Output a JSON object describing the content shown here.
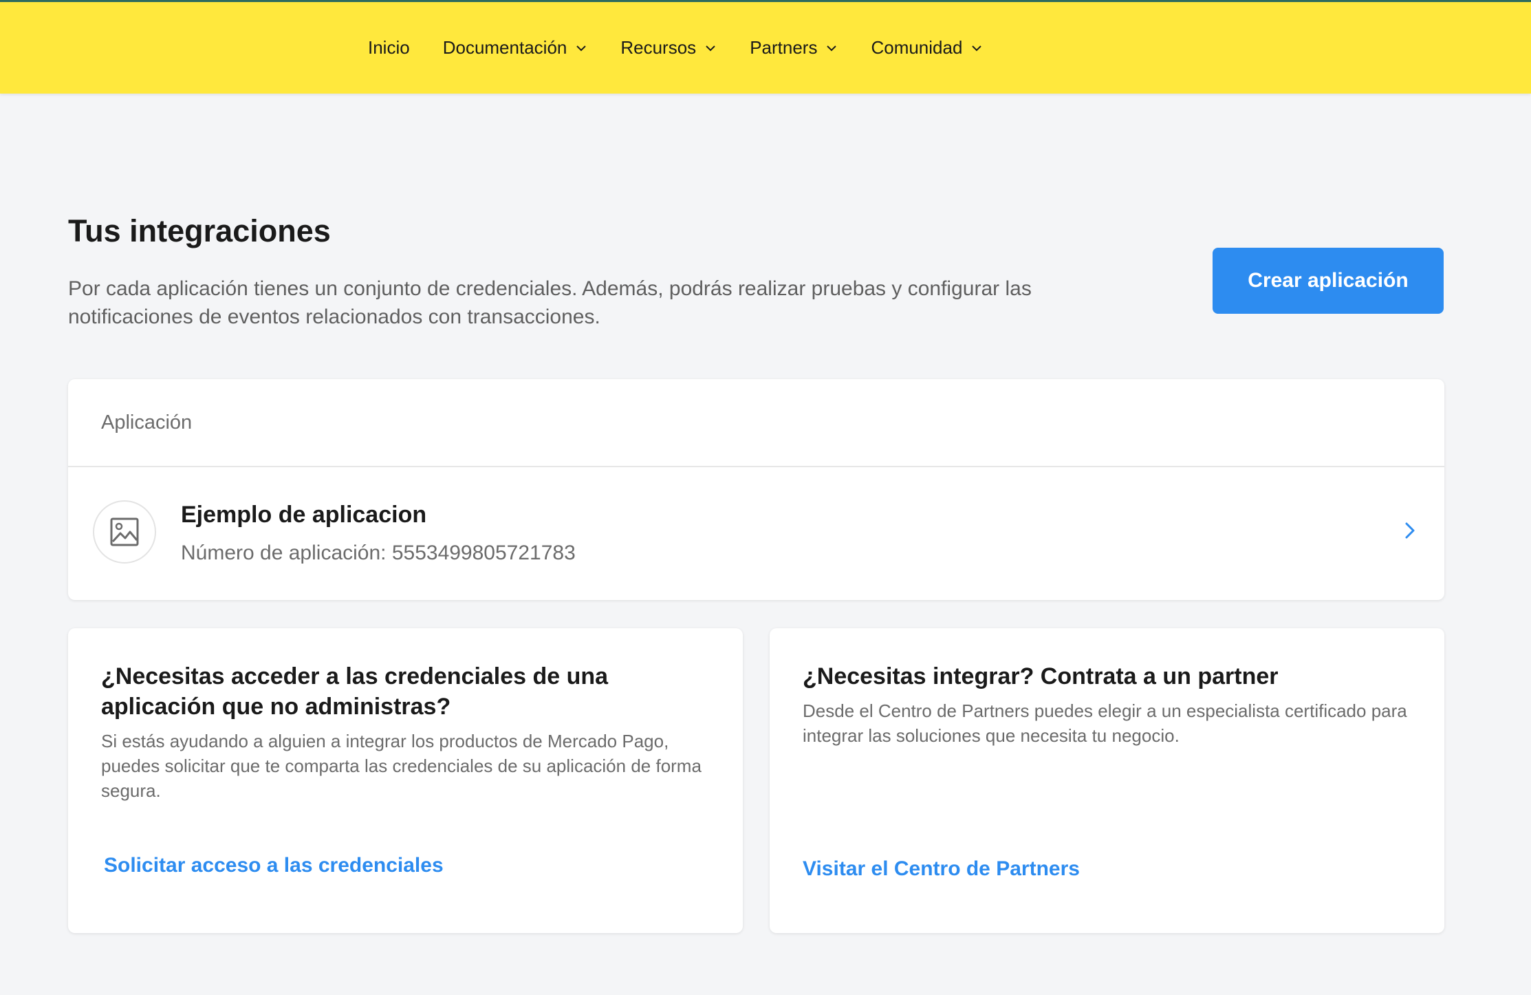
{
  "colors": {
    "header_bg": "#ffe83d",
    "accent_blue": "#2d8cf0",
    "page_bg": "#f4f5f7"
  },
  "nav": {
    "items": [
      {
        "label": "Inicio",
        "has_dropdown": false
      },
      {
        "label": "Documentación",
        "has_dropdown": true,
        "icon": "chevron-down-icon"
      },
      {
        "label": "Recursos",
        "has_dropdown": true,
        "icon": "chevron-down-icon"
      },
      {
        "label": "Partners",
        "has_dropdown": true,
        "icon": "chevron-down-icon"
      },
      {
        "label": "Comunidad",
        "has_dropdown": true,
        "icon": "chevron-down-icon"
      }
    ]
  },
  "page": {
    "title": "Tus integraciones",
    "description": "Por cada aplicación tienes un conjunto de credenciales. Además, podrás realizar pruebas y configurar las notificaciones de eventos relacionados con transacciones.",
    "create_button": "Crear aplicación"
  },
  "applications": {
    "header": "Aplicación",
    "items": [
      {
        "name": "Ejemplo de aplicacion",
        "number_text": "Número de aplicación: 5553499805721783",
        "icon": "image-placeholder-icon"
      }
    ]
  },
  "cards": {
    "credentials": {
      "title": "¿Necesitas acceder a las credenciales de una aplicación que no administras?",
      "text": "Si estás ayudando a alguien a integrar los productos de Mercado Pago, puedes solicitar que te comparta las credenciales de su aplicación de forma segura.",
      "link": "Solicitar acceso a las credenciales"
    },
    "partners": {
      "title": "¿Necesitas integrar? Contrata a un partner",
      "text": "Desde el Centro de Partners puedes elegir a un especialista certificado para integrar las soluciones que necesita tu negocio.",
      "link": "Visitar el Centro de Partners"
    }
  }
}
